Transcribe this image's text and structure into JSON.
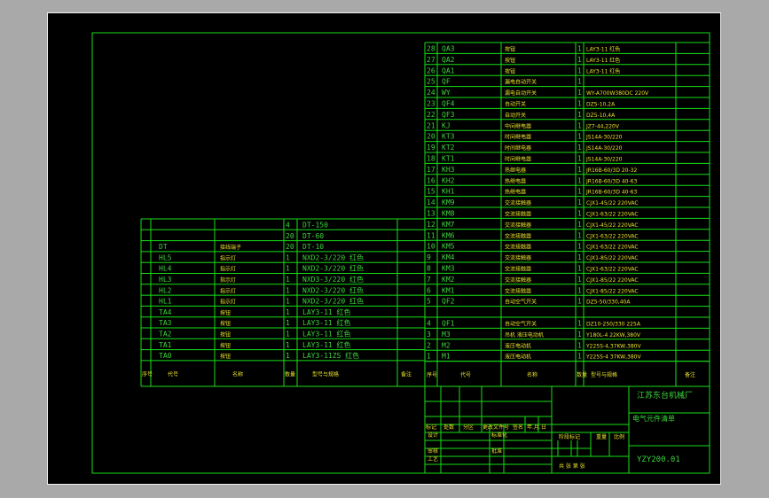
{
  "right_table": [
    {
      "no": "28",
      "code": "QA3",
      "name": "按钮",
      "qty": "1",
      "spec": "LAY3-11 红色"
    },
    {
      "no": "27",
      "code": "QA2",
      "name": "按钮",
      "qty": "1",
      "spec": "LAY3-11 红色"
    },
    {
      "no": "26",
      "code": "QA1",
      "name": "按钮",
      "qty": "1",
      "spec": "LAY3-11 红色"
    },
    {
      "no": "25",
      "code": "QF",
      "name": "漏电自动开关",
      "qty": "1",
      "spec": ""
    },
    {
      "no": "24",
      "code": "WY",
      "name": "漏电自动开关",
      "qty": "1",
      "spec": "WY-A700W380DC 220V"
    },
    {
      "no": "23",
      "code": "QF4",
      "name": "自动开关",
      "qty": "1",
      "spec": "DZ5-10,2A"
    },
    {
      "no": "22",
      "code": "QF3",
      "name": "自动开关",
      "qty": "1",
      "spec": "DZ5-10,4A"
    },
    {
      "no": "21",
      "code": "KJ",
      "name": "中间继电器",
      "qty": "1",
      "spec": "JZ7-44,220V"
    },
    {
      "no": "20",
      "code": "KT3",
      "name": "时间继电器",
      "qty": "1",
      "spec": "JS14A-30/220"
    },
    {
      "no": "19",
      "code": "KT2",
      "name": "时间继电器",
      "qty": "1",
      "spec": "JS14A-30/220"
    },
    {
      "no": "18",
      "code": "KT1",
      "name": "时间继电器",
      "qty": "1",
      "spec": "JS14A-30/220"
    },
    {
      "no": "17",
      "code": "KH3",
      "name": "热继电器",
      "qty": "1",
      "spec": "JR16B-60/3D 20-32"
    },
    {
      "no": "16",
      "code": "KH2",
      "name": "热继电器",
      "qty": "1",
      "spec": "JR16B-60/3D 40-63"
    },
    {
      "no": "15",
      "code": "KH1",
      "name": "热继电器",
      "qty": "1",
      "spec": "JR16B-60/3D 40-63"
    },
    {
      "no": "14",
      "code": "KM9",
      "name": "交流接触器",
      "qty": "1",
      "spec": "CJX1-45/22 220VAC"
    },
    {
      "no": "13",
      "code": "KM8",
      "name": "交流接触器",
      "qty": "1",
      "spec": "CJX1-63/22 220VAC"
    },
    {
      "no": "12",
      "code": "KM7",
      "name": "交流接触器",
      "qty": "1",
      "spec": "CJX1-45/22 220VAC"
    },
    {
      "no": "11",
      "code": "KM6",
      "name": "交流接触器",
      "qty": "1",
      "spec": "CJX1-63/22 220VAC"
    },
    {
      "no": "10",
      "code": "KM5",
      "name": "交流接触器",
      "qty": "1",
      "spec": "CJX1-63/22 220VAC"
    },
    {
      "no": "9",
      "code": "KM4",
      "name": "交流接触器",
      "qty": "1",
      "spec": "CJX1-85/22 220VAC"
    },
    {
      "no": "8",
      "code": "KM3",
      "name": "交流接触器",
      "qty": "1",
      "spec": "CJX1-63/22 220VAC"
    },
    {
      "no": "7",
      "code": "KM2",
      "name": "交流接触器",
      "qty": "1",
      "spec": "CJX1-85/22 220VAC"
    },
    {
      "no": "6",
      "code": "KM1",
      "name": "交流接触器",
      "qty": "1",
      "spec": "CJX1-85/22 220VAC"
    },
    {
      "no": "5",
      "code": "QF2",
      "name": "自动空气开关",
      "qty": "1",
      "spec": "DZ5-50/330,40A"
    },
    {
      "no": "",
      "code": "",
      "name": "",
      "qty": "",
      "spec": ""
    },
    {
      "no": "4",
      "code": "QF1",
      "name": "自动空气开关",
      "qty": "1",
      "spec": "DZ10-250/330 225A"
    },
    {
      "no": "3",
      "code": "M3",
      "name": "吊机 液压电动机",
      "qty": "1",
      "spec": "Y180L-4 22KW,380V"
    },
    {
      "no": "2",
      "code": "M2",
      "name": "液压电动机",
      "qty": "1",
      "spec": "Y225S-4,37KW,380V"
    },
    {
      "no": "1",
      "code": "M1",
      "name": "液压电动机",
      "qty": "1",
      "spec": "Y225S-4 37KW,380V"
    }
  ],
  "left_table": [
    {
      "no": "",
      "code": "",
      "name": "",
      "qty": "4",
      "spec": "DT-150"
    },
    {
      "no": "",
      "code": "",
      "name": "",
      "qty": "20",
      "spec": "DT-60"
    },
    {
      "no": "",
      "code": "DT",
      "name": "接线端子",
      "qty": "20",
      "spec": "DT-10"
    },
    {
      "no": "",
      "code": "HL5",
      "name": "指示灯",
      "qty": "1",
      "spec": "NXD2-3/220 红色"
    },
    {
      "no": "",
      "code": "HL4",
      "name": "指示灯",
      "qty": "1",
      "spec": "NXD2-3/220 红色"
    },
    {
      "no": "",
      "code": "HL3",
      "name": "指示灯",
      "qty": "1",
      "spec": "NXD3-3/220 红色"
    },
    {
      "no": "",
      "code": "HL2",
      "name": "指示灯",
      "qty": "1",
      "spec": "NXD2-3/220 红色"
    },
    {
      "no": "",
      "code": "HL1",
      "name": "指示灯",
      "qty": "1",
      "spec": "NXD2-3/220 红色"
    },
    {
      "no": "",
      "code": "TA4",
      "name": "按钮",
      "qty": "1",
      "spec": "LAY3-11 红色"
    },
    {
      "no": "",
      "code": "TA3",
      "name": "按钮",
      "qty": "1",
      "spec": "LAY3-11 红色"
    },
    {
      "no": "",
      "code": "TA2",
      "name": "按钮",
      "qty": "1",
      "spec": "LAY3-11 红色"
    },
    {
      "no": "",
      "code": "TA1",
      "name": "按钮",
      "qty": "1",
      "spec": "LAY3-11 红色"
    },
    {
      "no": "",
      "code": "TA0",
      "name": "按钮",
      "qty": "1",
      "spec": "LAY3-11ZS 红色"
    }
  ],
  "left_header": {
    "no": "序号",
    "code": "代号",
    "name": "名称",
    "qty": "数量",
    "spec": "型号与规格",
    "note": "备注"
  },
  "right_header": {
    "no": "序号",
    "code": "代号",
    "name": "名称",
    "qty": "数量",
    "spec": "型号与规格",
    "note": "备注"
  },
  "title_block": {
    "company": "江苏东台机械厂",
    "drawing_name": "电气元件清单",
    "drawing_no": "YZY200.01",
    "labels_row": [
      "标记",
      "处数",
      "分区",
      "更改文件号",
      "签名",
      "年.月.日"
    ],
    "design": "设计",
    "standard": "标准化",
    "check": "审核",
    "craft": "工艺",
    "approve": "批准",
    "stage_mark": "阶段标记",
    "weight": "重量",
    "scale": "比例",
    "sheets": "共 张 第 张"
  },
  "colors": {
    "line": "#16e016",
    "text": "#3cd43c",
    "accent": "#e8e02a",
    "background": "#000000",
    "frame": "#a9a9a9"
  }
}
